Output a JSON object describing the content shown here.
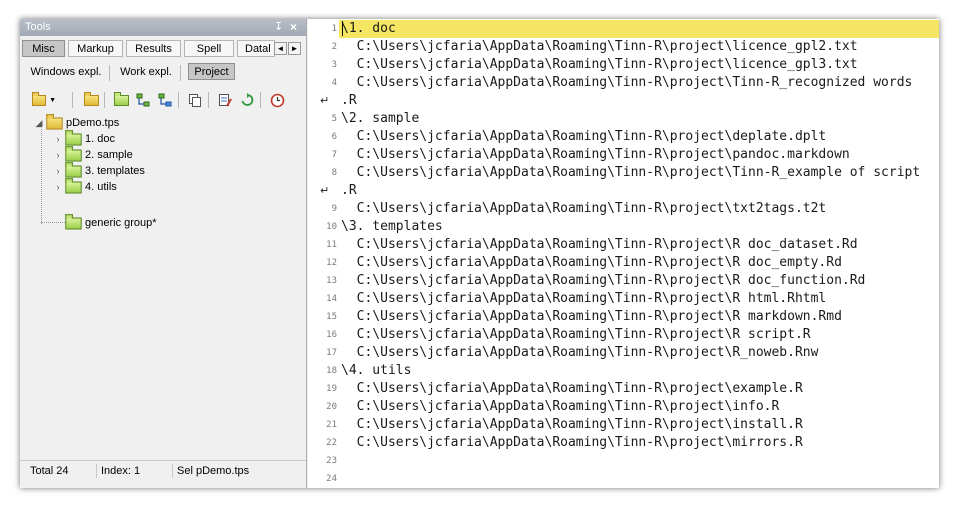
{
  "tools": {
    "title": "Tools",
    "pin": "↧",
    "close": "×",
    "tabs_row1": [
      "Misc",
      "Markup",
      "Results",
      "Spell",
      "Datal"
    ],
    "tabs_row2": [
      "Windows expl.",
      "Work expl.",
      "Project"
    ],
    "active_tab_row1": "Misc",
    "active_tab_row2": "Project",
    "arrow_left": "◄",
    "arrow_right": "►",
    "toolbar_icons": [
      "open-project-icon",
      "dropdown-icon",
      "folder-icon",
      "new-folder-icon",
      "add-group-icon",
      "remove-group-icon",
      "copy-icon",
      "edit-icon",
      "refresh-icon",
      "history-icon"
    ],
    "tree": {
      "root": "pDemo.tps",
      "groups": [
        "1. doc",
        "2. sample",
        "3. templates",
        "4. utils",
        "generic group*"
      ]
    },
    "status": {
      "total": "Total  24",
      "index": "Index:  1",
      "sel": "Sel  pDemo.tps"
    }
  },
  "editor": {
    "current_line": 1,
    "lines": [
      {
        "n": "1",
        "text": "\\1. doc"
      },
      {
        "n": "2",
        "text": "  C:\\Users\\jcfaria\\AppData\\Roaming\\Tinn-R\\project\\licence_gpl2.txt"
      },
      {
        "n": "3",
        "text": "  C:\\Users\\jcfaria\\AppData\\Roaming\\Tinn-R\\project\\licence_gpl3.txt"
      },
      {
        "n": "4",
        "text": "  C:\\Users\\jcfaria\\AppData\\Roaming\\Tinn-R\\project\\Tinn-R_recognized words"
      },
      {
        "n": "",
        "text": ".R",
        "wrap": true
      },
      {
        "n": "5",
        "text": "\\2. sample"
      },
      {
        "n": "6",
        "text": "  C:\\Users\\jcfaria\\AppData\\Roaming\\Tinn-R\\project\\deplate.dplt"
      },
      {
        "n": "7",
        "text": "  C:\\Users\\jcfaria\\AppData\\Roaming\\Tinn-R\\project\\pandoc.markdown"
      },
      {
        "n": "8",
        "text": "  C:\\Users\\jcfaria\\AppData\\Roaming\\Tinn-R\\project\\Tinn-R_example of script"
      },
      {
        "n": "",
        "text": ".R",
        "wrap": true
      },
      {
        "n": "9",
        "text": "  C:\\Users\\jcfaria\\AppData\\Roaming\\Tinn-R\\project\\txt2tags.t2t"
      },
      {
        "n": "10",
        "text": "\\3. templates"
      },
      {
        "n": "11",
        "text": "  C:\\Users\\jcfaria\\AppData\\Roaming\\Tinn-R\\project\\R doc_dataset.Rd"
      },
      {
        "n": "12",
        "text": "  C:\\Users\\jcfaria\\AppData\\Roaming\\Tinn-R\\project\\R doc_empty.Rd"
      },
      {
        "n": "13",
        "text": "  C:\\Users\\jcfaria\\AppData\\Roaming\\Tinn-R\\project\\R doc_function.Rd"
      },
      {
        "n": "14",
        "text": "  C:\\Users\\jcfaria\\AppData\\Roaming\\Tinn-R\\project\\R html.Rhtml"
      },
      {
        "n": "15",
        "text": "  C:\\Users\\jcfaria\\AppData\\Roaming\\Tinn-R\\project\\R markdown.Rmd"
      },
      {
        "n": "16",
        "text": "  C:\\Users\\jcfaria\\AppData\\Roaming\\Tinn-R\\project\\R script.R"
      },
      {
        "n": "17",
        "text": "  C:\\Users\\jcfaria\\AppData\\Roaming\\Tinn-R\\project\\R_noweb.Rnw"
      },
      {
        "n": "18",
        "text": "\\4. utils"
      },
      {
        "n": "19",
        "text": "  C:\\Users\\jcfaria\\AppData\\Roaming\\Tinn-R\\project\\example.R"
      },
      {
        "n": "20",
        "text": "  C:\\Users\\jcfaria\\AppData\\Roaming\\Tinn-R\\project\\info.R"
      },
      {
        "n": "21",
        "text": "  C:\\Users\\jcfaria\\AppData\\Roaming\\Tinn-R\\project\\install.R"
      },
      {
        "n": "22",
        "text": "  C:\\Users\\jcfaria\\AppData\\Roaming\\Tinn-R\\project\\mirrors.R"
      },
      {
        "n": "23",
        "text": ""
      },
      {
        "n": "24",
        "text": ""
      }
    ],
    "wrap_marker": "↵",
    "current_line_color": "#f4e562"
  }
}
